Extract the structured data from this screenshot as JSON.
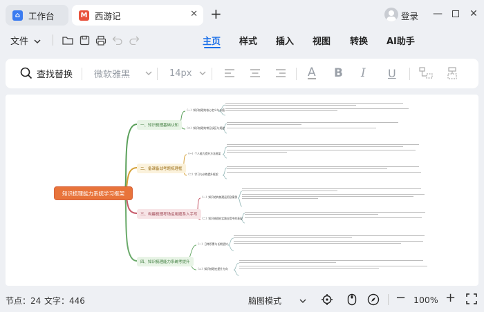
{
  "tabs": [
    {
      "label": "工作台",
      "icon": "workbench-icon"
    },
    {
      "label": "西游记",
      "icon": "mindmap-app-icon"
    }
  ],
  "window": {
    "login_label": "登录"
  },
  "menu": {
    "file_label": "文件",
    "tabs": [
      "主页",
      "样式",
      "插入",
      "视图",
      "转换",
      "AI助手"
    ],
    "active": "主页"
  },
  "toolbar": {
    "find_replace": "查找替换",
    "font_family": "微软雅黑",
    "font_size": "14px"
  },
  "mindmap": {
    "root": "知识梳理能力系统学习框架",
    "branches": [
      {
        "label": "一、知识梳理基础认知",
        "color": "#5aa05a",
        "subs": [
          "（一）知识梳理的核心定义与价值",
          "（二）知识梳理的常见误区与规避"
        ]
      },
      {
        "label": "二、备课备战考题梳理框",
        "color": "#d6a23a",
        "subs": [
          "（一）个人能力提升方法框架",
          "（二）学习与训练提升框架"
        ]
      },
      {
        "label": "三、构建梳理考场运用题系入手写",
        "color": "#c85b6b",
        "subs": [
          "（一）知识结构梳理运用及案例",
          "（二）知识梳理在实践应用中的表现"
        ]
      },
      {
        "label": "四、知识梳理能力系统考提升",
        "color": "#6aaa6a",
        "subs": [
          "（一）日常积累与长期坚持",
          "（二）知识梳理在提升方向"
        ]
      }
    ]
  },
  "status": {
    "nodes_label": "节点：",
    "nodes_value": "24",
    "words_label": "文字：",
    "words_value": "446",
    "mode": "脑图模式",
    "zoom": "100%"
  },
  "colors": {
    "accent": "#1a6fe8",
    "root_bg": "#e8743b",
    "root_border": "#d9633a"
  }
}
